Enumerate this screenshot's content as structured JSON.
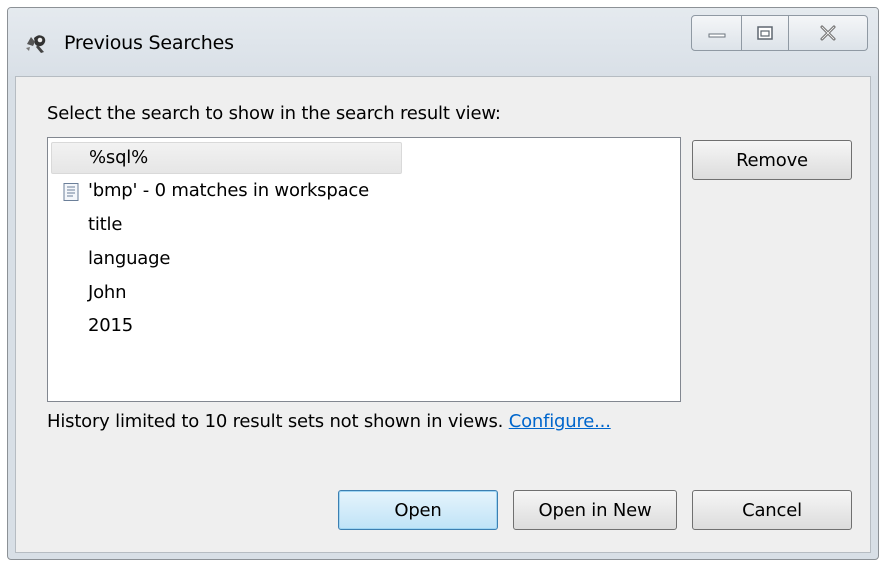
{
  "window": {
    "title": "Previous Searches"
  },
  "dialog": {
    "instruction": "Select the search to show in the search result view:",
    "items": [
      {
        "label": "%sql%",
        "selected": true,
        "icon": null
      },
      {
        "label": "'bmp' - 0 matches in workspace",
        "selected": false,
        "icon": "document-icon"
      },
      {
        "label": "title",
        "selected": false,
        "icon": null
      },
      {
        "label": "language",
        "selected": false,
        "icon": null
      },
      {
        "label": "John",
        "selected": false,
        "icon": null
      },
      {
        "label": "2015",
        "selected": false,
        "icon": null
      }
    ],
    "remove_label": "Remove",
    "history_note": "History limited to 10 result sets not shown in views.",
    "configure_link": "Configure...",
    "open_label": "Open",
    "open_new_label": "Open in New",
    "cancel_label": "Cancel"
  },
  "colors": {
    "link": "#0066cc",
    "default_button_border": "#3c7fb1"
  }
}
